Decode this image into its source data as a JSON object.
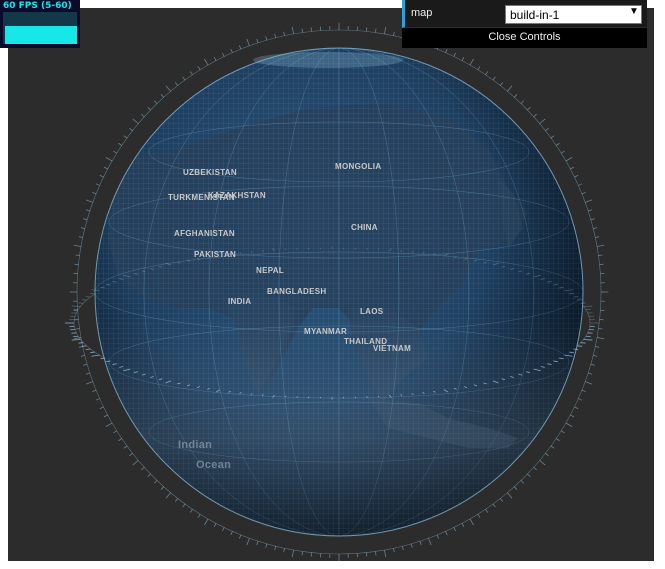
{
  "stats": {
    "fps_text": "60 FPS (5-60)",
    "fps": 60,
    "fps_min": 5,
    "fps_max": 60
  },
  "gui": {
    "map_label": "map",
    "map_value": "build-in-1",
    "map_options": [
      "build-in-1"
    ],
    "close_label": "Close Controls"
  },
  "globe": {
    "colors": {
      "viewport_bg": "#2c2c2c",
      "ocean": "#1f3d5c",
      "land": "#23364b",
      "grid": "#5e8fb3",
      "atmosphere": "#7fb8d8"
    },
    "map_labels": [
      "CHINA",
      "INDIA",
      "PAKISTAN",
      "AFGHANISTAN",
      "NEPAL",
      "BANGLADESH",
      "MYANMAR",
      "THAILAND",
      "LAOS",
      "VIETNAM",
      "KAZAKHSTAN",
      "MONGOLIA",
      "TURKMENISTAN",
      "UZBEKISTAN",
      "Indian",
      "Ocean"
    ]
  }
}
